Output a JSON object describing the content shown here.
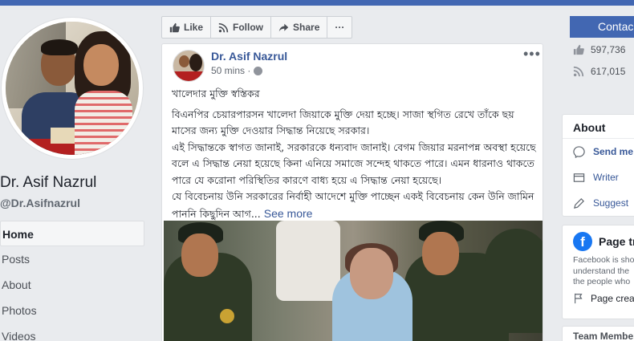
{
  "page": {
    "name": "Dr. Asif Nazrul",
    "handle": "@Dr.Asifnazrul"
  },
  "nav": {
    "items": [
      {
        "label": "Home"
      },
      {
        "label": "Posts"
      },
      {
        "label": "About"
      },
      {
        "label": "Photos"
      },
      {
        "label": "Videos"
      }
    ]
  },
  "action_bar": {
    "like": "Like",
    "follow": "Follow",
    "share": "Share",
    "more": "···"
  },
  "contact_button": "Contac",
  "post": {
    "author": "Dr. Asif Nazrul",
    "time": "50 mins ·",
    "more": "•••",
    "title": "খালেদার মুক্তি স্বস্তিকর",
    "body": [
      "বিএনপির চেয়ারপারসন খালেদা জিয়াকে মুক্তি দেয়া হচ্ছে। সাজা স্থগিত রেখে তাঁকে ছয় মাসের জন্য মুক্তি দেওয়ার সিদ্ধান্ত নিয়েছে সরকার।",
      "এই সিদ্ধান্তকে স্বাগত জানাই, সরকারকে ধন্যবাদ জানাই। বেগম জিয়ার মরনাপন্ন অবস্থা হয়েছে বলে এ সিদ্ধান্ত নেয়া হয়েছে কিনা এনিয়ে সমাজে সন্দেহ থাকতে পারে। এমন ধারনাও থাকতে পারে যে করোনা পরিস্থিতির কারণে বাধ্য হয়ে এ সিদ্ধান্ত নেয়া হয়েছে।",
      "যে বিবেচনায় উনি সরকারের নির্বাহী আদেশে মুক্তি পাচ্ছেন একই বিবেচনায় কেন উনি জামিন পাননি কিছুদিন আগ..."
    ],
    "see_more": "See more"
  },
  "sidebar_right": {
    "stats": [
      {
        "icon": "like-icon",
        "value": "597,736"
      },
      {
        "icon": "rss-icon",
        "value": "617,015"
      }
    ],
    "about": {
      "title": "About",
      "items": [
        {
          "icon": "messenger-icon",
          "label": "Send me"
        },
        {
          "icon": "page-icon",
          "label": "Writer"
        },
        {
          "icon": "edit-icon",
          "label": "Suggest"
        }
      ]
    },
    "page_transparency": {
      "title": "Page tr",
      "desc": [
        "Facebook is sho",
        "understand the",
        "the people who"
      ],
      "create": "Page crea"
    },
    "team": {
      "title": "Team Members"
    }
  },
  "colors": {
    "brand": "#4267b2",
    "link": "#385898",
    "background": "#e9ebee"
  }
}
